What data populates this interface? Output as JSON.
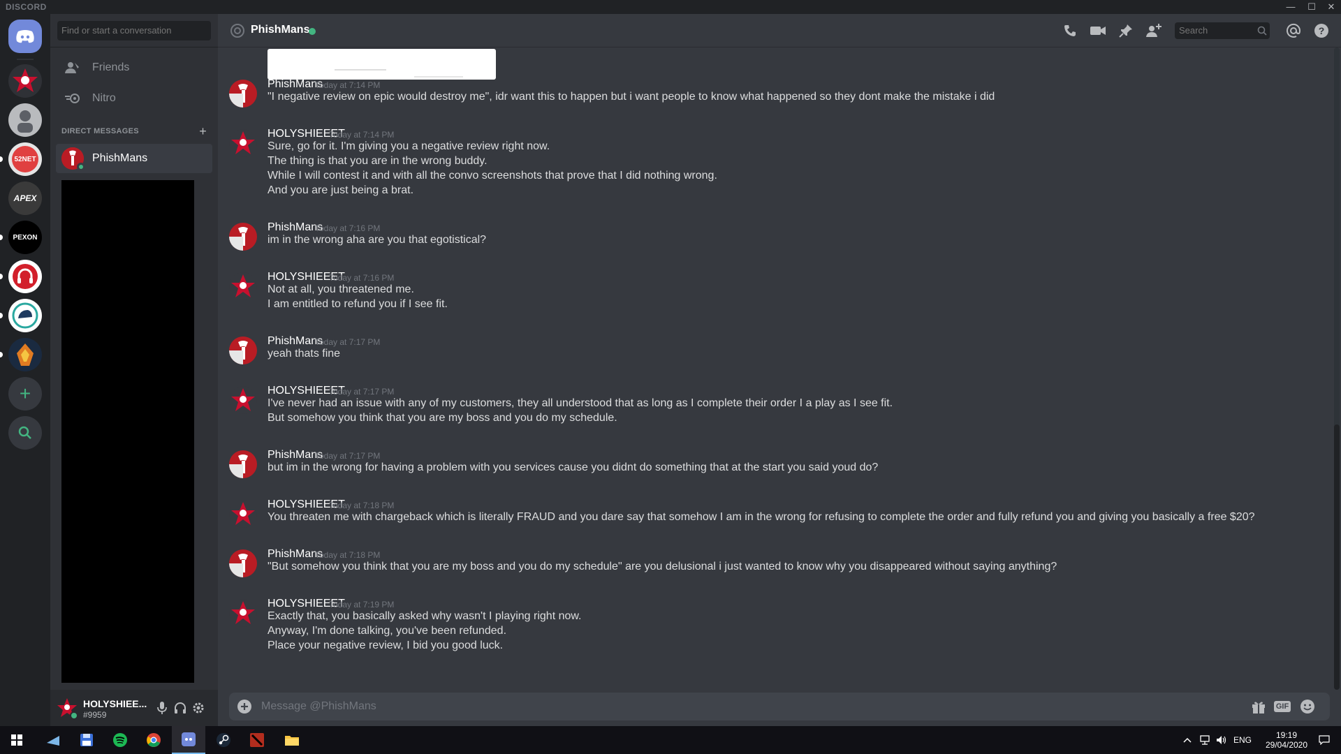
{
  "app": {
    "brand": "DISCORD"
  },
  "window_controls": {
    "minimize": "—",
    "maximize": "☐",
    "close": "✕"
  },
  "dm_sidebar": {
    "search_placeholder": "Find or start a conversation",
    "nav": [
      {
        "label": "Friends",
        "icon": "friends-icon"
      },
      {
        "label": "Nitro",
        "icon": "nitro-icon"
      }
    ],
    "section_header": "DIRECT MESSAGES",
    "add_symbol": "+",
    "active_dm": {
      "name": "PhishMans",
      "status": "online"
    }
  },
  "guilds": [
    {
      "name": "home",
      "label": ""
    },
    {
      "name": "guild-red-emblem",
      "label": ""
    },
    {
      "name": "guild-character",
      "label": ""
    },
    {
      "name": "guild-52net",
      "label": "52NET"
    },
    {
      "name": "guild-apex",
      "label": "APEX"
    },
    {
      "name": "guild-pexon",
      "label": "PEXON"
    },
    {
      "name": "guild-headset",
      "label": ""
    },
    {
      "name": "guild-cap",
      "label": ""
    },
    {
      "name": "guild-fire-emblem",
      "label": ""
    }
  ],
  "user_panel": {
    "username": "HOLYSHIEE...",
    "tag": "#9959"
  },
  "chat_header": {
    "title": "PhishMans",
    "search_placeholder": "Search"
  },
  "messages": [
    {
      "author": "PhishMans",
      "time": "Today at 7:14 PM",
      "lines": [
        "\"I negative review on epic would destroy me\", idr want this to happen but i want people to know what happened so they dont make the mistake i did"
      ]
    },
    {
      "author": "HOLYSHIEEET",
      "time": "Today at 7:14 PM",
      "lines": [
        "Sure, go for it. I'm giving you a negative review right now.",
        "The thing is that you are in the wrong buddy.",
        "While I will contest it and with all the convo screenshots that prove that I did nothing wrong.",
        "And you are just being a brat."
      ]
    },
    {
      "author": "PhishMans",
      "time": "Today at 7:16 PM",
      "lines": [
        "im in the wrong aha are you that egotistical?"
      ]
    },
    {
      "author": "HOLYSHIEEET",
      "time": "Today at 7:16 PM",
      "lines": [
        "Not at all, you threatened me.",
        "I am entitled to refund you if I see fit."
      ]
    },
    {
      "author": "PhishMans",
      "time": "Today at 7:17 PM",
      "lines": [
        "yeah thats fine"
      ]
    },
    {
      "author": "HOLYSHIEEET",
      "time": "Today at 7:17 PM",
      "lines": [
        "I've never had an issue with any of my customers, they all understood that as long as I complete their order I a play as I see fit.",
        "But somehow you think that you are my boss and you do my schedule."
      ]
    },
    {
      "author": "PhishMans",
      "time": "Today at 7:17 PM",
      "lines": [
        "but im in the wrong for having a problem with you services cause you didnt do something that at the start you said youd do?"
      ]
    },
    {
      "author": "HOLYSHIEEET",
      "time": "Today at 7:18 PM",
      "lines": [
        "You threaten me with chargeback which is literally FRAUD and you dare say that somehow I am in the wrong for refusing to complete the order and fully refund you and giving you basically a free $20?"
      ]
    },
    {
      "author": "PhishMans",
      "time": "Today at 7:18 PM",
      "lines": [
        "\"But somehow you think that you are my boss and you do my schedule\" are you delusional i just wanted to know why you disappeared without saying anything?"
      ]
    },
    {
      "author": "HOLYSHIEEET",
      "time": "Today at 7:19 PM",
      "lines": [
        "Exactly that, you basically asked why wasn't I playing right now.",
        "Anyway, I'm done talking, you've been refunded.",
        "Place your negative review, I bid you good luck."
      ]
    }
  ],
  "composer": {
    "placeholder": "Message @PhishMans",
    "gif_label": "GIF"
  },
  "taskbar": {
    "language": "ENG",
    "time": "19:19",
    "date": "29/04/2020"
  },
  "colors": {
    "accent": "#7289da",
    "online": "#43b581",
    "background": "#36393f"
  }
}
